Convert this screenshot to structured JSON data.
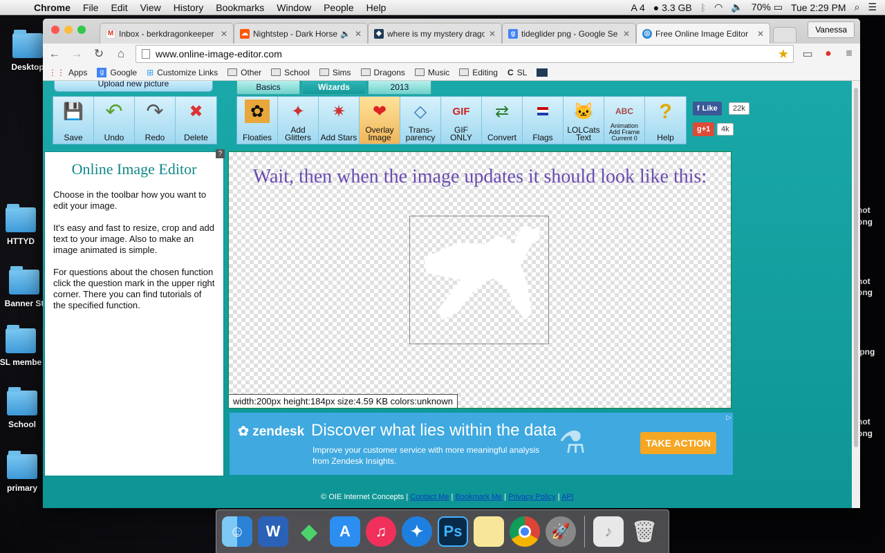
{
  "menubar": {
    "app_name": "Chrome",
    "items": [
      "File",
      "Edit",
      "View",
      "History",
      "Bookmarks",
      "Window",
      "People",
      "Help"
    ],
    "status_count": "4",
    "memory": "3.3 GB",
    "battery": "70%",
    "clock": "Tue 2:29 PM"
  },
  "desktop": {
    "icons": [
      "Desktop",
      "HTTYD",
      "Banner St",
      "SL membe",
      "School",
      "primary"
    ],
    "right_labels": [
      "not",
      "png",
      "not",
      "png",
      ".png",
      "not",
      "png"
    ]
  },
  "browser": {
    "tabs": [
      {
        "title": "Inbox - berkdragonkeeper",
        "icon": "gmail-icon"
      },
      {
        "title": "Nightstep - Dark Horse",
        "icon": "soundcloud-icon"
      },
      {
        "title": "where is my mystery drago",
        "icon": "dragon-icon"
      },
      {
        "title": "tideglider png - Google Se",
        "icon": "google-icon"
      },
      {
        "title": "Free Online Image Editor",
        "icon": "editor-icon"
      }
    ],
    "profile": "Vanessa",
    "url": "www.online-image-editor.com",
    "bookmarks": [
      "Apps",
      "Google",
      "Customize Links",
      "Other",
      "School",
      "Sims",
      "Dragons",
      "Music",
      "Editing",
      "SL"
    ]
  },
  "page": {
    "upload_label": "Upload new picture",
    "top_tabs": [
      "Basics",
      "Wizards",
      "2013"
    ],
    "basic_tools": [
      "Save",
      "Undo",
      "Redo",
      "Delete"
    ],
    "wizard_tools": [
      "Floaties",
      "Add\nGlitters",
      "Add Stars",
      "Overlay\nImage",
      "Trans-\nparency",
      "GIF\nONLY",
      "Convert",
      "Flags",
      "LOLCats\nText",
      "Add Frame\nCurrent 0",
      "Help"
    ],
    "animation_label": "Animation",
    "social": {
      "like": "Like",
      "like_count": "22k",
      "gplus": "g+1",
      "gplus_count": "4k"
    },
    "sidebar": {
      "title": "Online Image Editor",
      "help_icon": "?",
      "paragraphs": [
        "Choose in the toolbar how you want to edit your image.",
        "It's easy and fast to resize, crop and add text to your image. Also to make an image animated is simple.",
        "For questions about the chosen function click the question mark in the upper right corner. There you can find tutorials of the specified function."
      ]
    },
    "canvas": {
      "message": "Wait, then when the image updates it should look like this:",
      "info": "width:200px  height:184px  size:4.59 KB  colors:unknown"
    },
    "ad": {
      "brand": "zendesk",
      "headline": "Discover what lies within the data",
      "sub": "Improve your customer service with more meaningful analysis from Zendesk Insights.",
      "cta": "TAKE ACTION"
    },
    "footer": {
      "copyright": "© OIE Internet Concepts",
      "links": [
        "Contact Me",
        "Bookmark Me",
        "Privacy Policy",
        "API"
      ]
    }
  },
  "dock": [
    "Finder",
    "W",
    "Sims",
    "App Store",
    "iTunes",
    "Safari",
    "Ps",
    "Notes",
    "Chrome",
    "Launchpad",
    "Documents",
    "Trash"
  ]
}
